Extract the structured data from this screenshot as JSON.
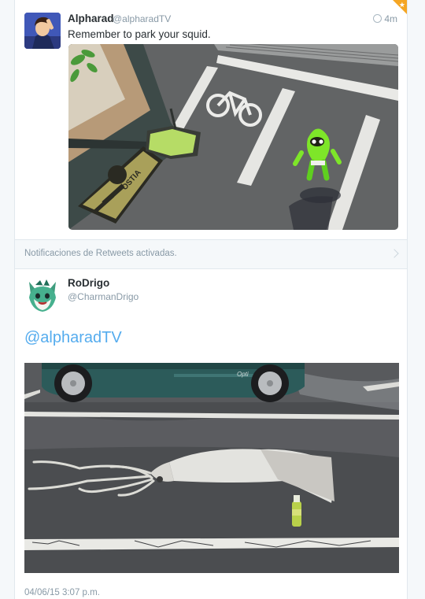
{
  "tweet1": {
    "name": "Alpharad",
    "handle": "@alpharadTV",
    "time": "4m",
    "text": "Remember to park your squid.",
    "mat_text": "OSTIA"
  },
  "retweet_notice": {
    "text": "Notificaciones de Retweets activadas."
  },
  "tweet2": {
    "name": "RoDrigo",
    "handle": "@CharmanDrigo",
    "text": "@alpharadTV",
    "date": "04/06/15 3:07 p.m.",
    "car_badge": "Opti"
  },
  "colors": {
    "link": "#55acee",
    "muted": "#8899a6",
    "text": "#292f33",
    "notification_corner": "#f5a623"
  }
}
